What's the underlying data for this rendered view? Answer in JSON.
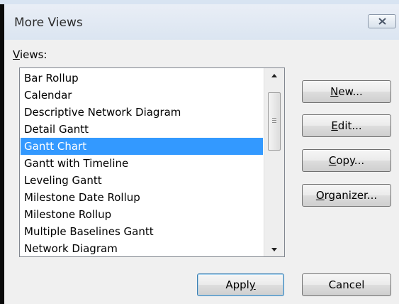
{
  "window": {
    "title": "More Views",
    "close_icon": "close-icon"
  },
  "views_label": {
    "mnemonic": "V",
    "rest": "iews:"
  },
  "views": {
    "items": [
      "Bar Rollup",
      "Calendar",
      "Descriptive Network Diagram",
      "Detail Gantt",
      "Gantt Chart",
      "Gantt with Timeline",
      "Leveling Gantt",
      "Milestone Date Rollup",
      "Milestone Rollup",
      "Multiple Baselines Gantt",
      "Network Diagram"
    ],
    "selected": "Gantt Chart",
    "selection_color": "#3399ff"
  },
  "buttons": {
    "new": {
      "mnemonic": "N",
      "rest": "ew..."
    },
    "edit": {
      "mnemonic": "E",
      "rest": "dit..."
    },
    "copy": {
      "mnemonic": "C",
      "rest": "opy..."
    },
    "organizer": {
      "mnemonic": "O",
      "rest": "rganizer..."
    },
    "apply": {
      "prefix": "Appl",
      "mnemonic": "y"
    },
    "cancel": {
      "label": "Cancel"
    }
  }
}
